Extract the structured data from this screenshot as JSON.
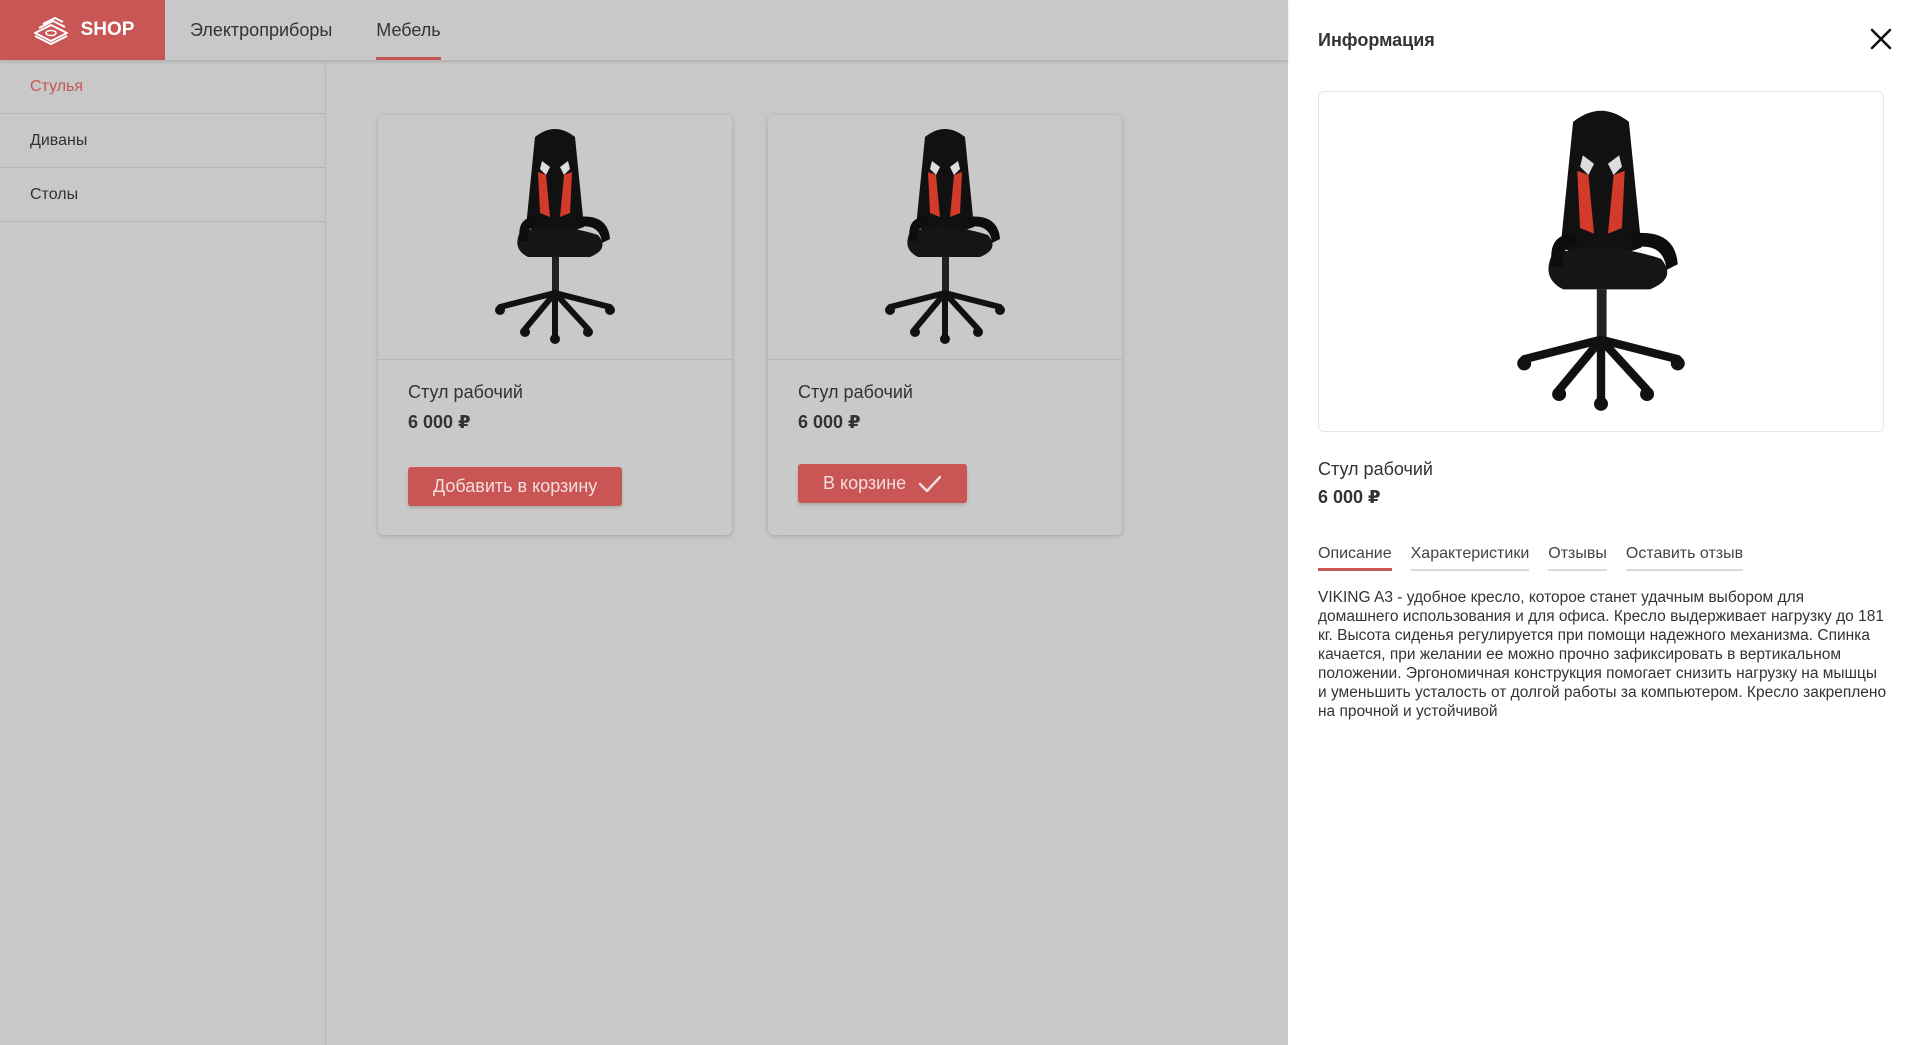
{
  "header": {
    "logo_text": "SHOP",
    "nav": [
      {
        "label": "Электроприборы",
        "active": false
      },
      {
        "label": "Мебель",
        "active": true
      }
    ]
  },
  "sidebar": {
    "items": [
      {
        "label": "Стулья",
        "active": true
      },
      {
        "label": "Диваны",
        "active": false
      },
      {
        "label": "Столы",
        "active": false
      }
    ]
  },
  "products": [
    {
      "title": "Стул рабочий",
      "price": "6 000 ₽",
      "button_label": "Добавить в корзину",
      "in_cart": false
    },
    {
      "title": "Стул рабочий",
      "price": "6 000 ₽",
      "button_label": "В корзине",
      "in_cart": true
    }
  ],
  "drawer": {
    "title": "Информация",
    "product_name": "Стул рабочий",
    "product_price": "6 000 ₽",
    "tabs": [
      {
        "label": "Описание",
        "active": true
      },
      {
        "label": "Характеристики",
        "active": false
      },
      {
        "label": "Отзывы",
        "active": false
      },
      {
        "label": "Оставить отзыв",
        "active": false
      }
    ],
    "description": "VIKING A3 - удобное кресло, которое станет удачным выбором для домашнего использования и для офиса. Кресло выдерживает нагрузку до 181 кг. Высота сиденья регулируется при помощи надежного механизма. Спинка качается, при желании ее можно прочно зафиксировать в вертикальном положении. Эргономичная конструкция помогает снизить нагрузку на мышцы и уменьшить усталость от долгой работы за компьютером. Кресло закреплено на прочной и устойчивой"
  },
  "colors": {
    "accent": "#c95555",
    "overlay_bg": "#c8c8c8",
    "drawer_bg": "#ffffff"
  },
  "icons": {
    "logo": "money-stack-icon",
    "close": "close-icon",
    "in_cart": "checkmark-icon"
  }
}
